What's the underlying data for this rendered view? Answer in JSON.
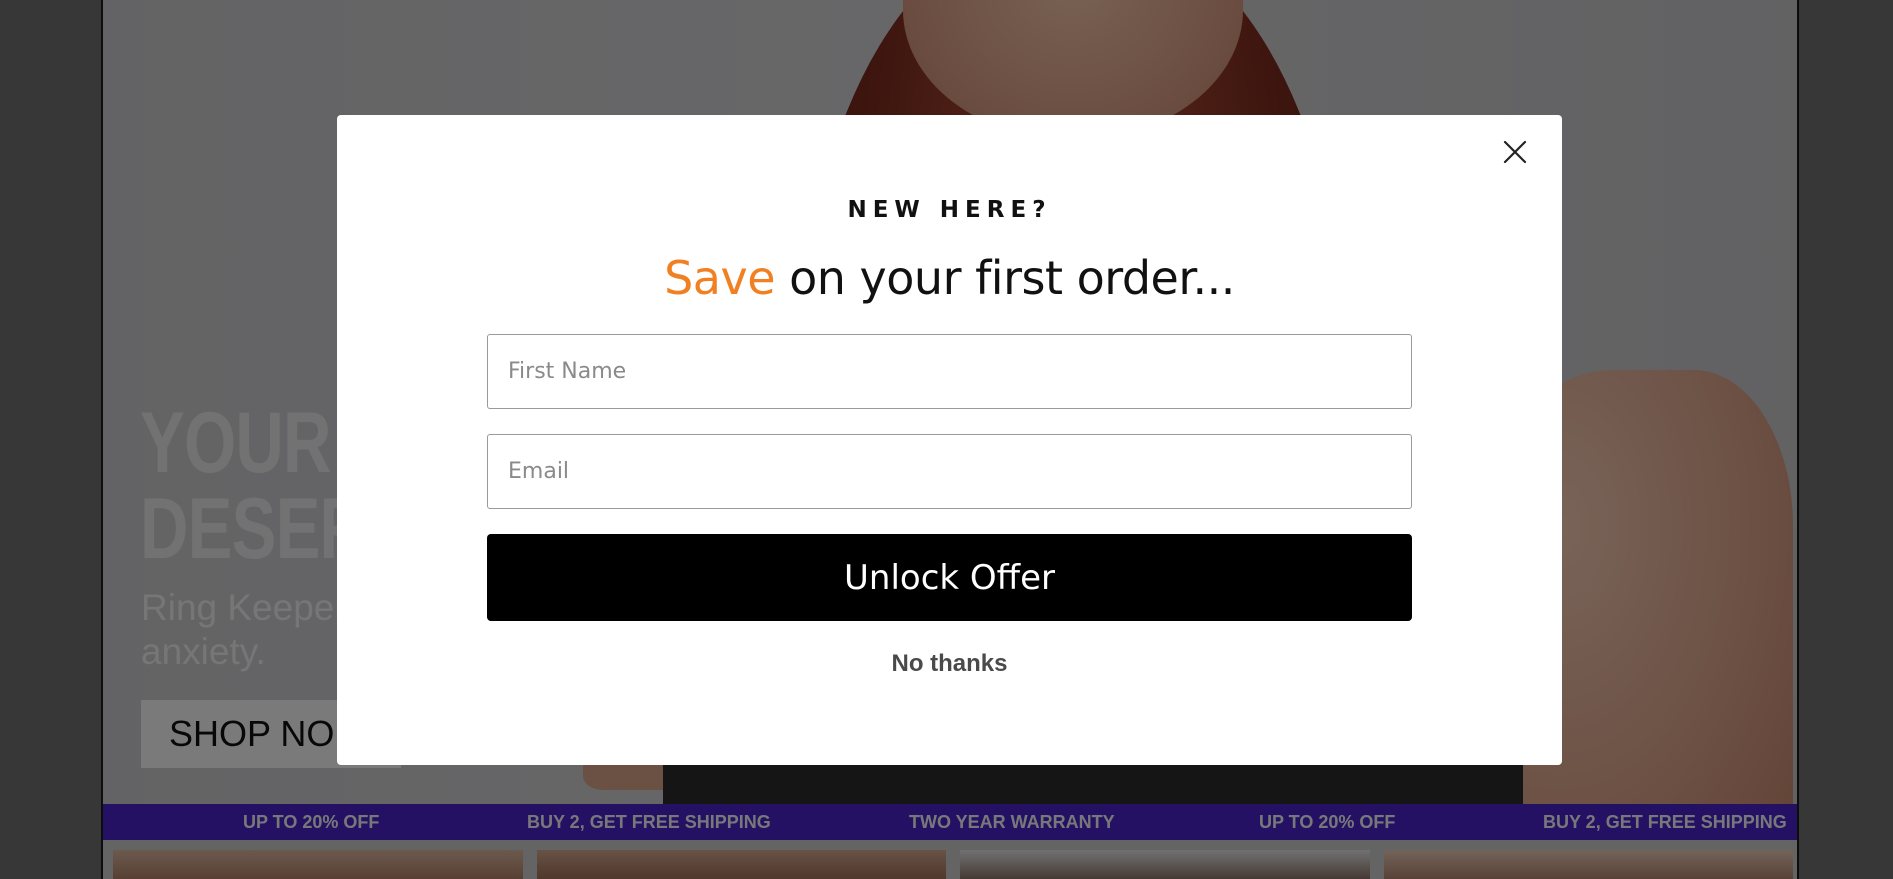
{
  "background_page": {
    "hero": {
      "headline": "YOUR R\nDESERV",
      "subtext": "Ring Keeper\nanxiety.",
      "shop_button": "SHOP NO"
    },
    "promo_strip": {
      "items": [
        "UP TO 20% OFF",
        "BUY 2, GET FREE SHIPPING",
        "TWO YEAR WARRANTY",
        "UP TO 20% OFF",
        "BUY 2, GET FREE SHIPPING"
      ],
      "background_color": "#4a23c7"
    }
  },
  "modal": {
    "eyebrow": "NEW HERE?",
    "headline_accent": "Save",
    "headline_rest": " on your first order...",
    "accent_color": "#f08021",
    "first_name_field": {
      "placeholder": "First Name",
      "value": ""
    },
    "email_field": {
      "placeholder": "Email",
      "value": ""
    },
    "submit_label": "Unlock Offer",
    "dismiss_label": "No thanks",
    "close_icon": "close-icon"
  }
}
